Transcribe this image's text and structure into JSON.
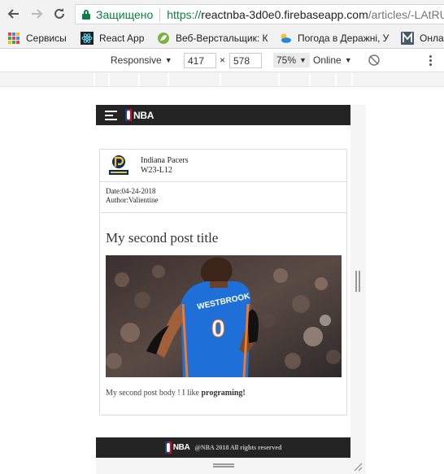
{
  "browser": {
    "security_label": "Защищено",
    "url_scheme": "https://",
    "url_host": "reactnba-3d0e0.firebaseapp.com",
    "url_path": "/articles/-LAtRU"
  },
  "bookmarks": [
    {
      "label": "Сервисы",
      "icon": "apps-grid-icon"
    },
    {
      "label": "React App",
      "icon": "react-icon"
    },
    {
      "label": "Веб-Верстальщик: К",
      "icon": "leaf-icon"
    },
    {
      "label": "Погода в Деражні, У",
      "icon": "weather-icon"
    },
    {
      "label": "Онла",
      "icon": "m-icon"
    }
  ],
  "devtools": {
    "device": "Responsive",
    "width": "417",
    "times": "×",
    "height": "578",
    "zoom": "75%",
    "throttle": "Online"
  },
  "page": {
    "logo_text": "NBA",
    "team": {
      "name": "Indiana Pacers",
      "record": "W23-L12"
    },
    "article": {
      "date": "Date:04-24-2018",
      "author": "Author:Valientine",
      "title": "My second post title",
      "body_prefix": "My second post body ! I like ",
      "body_bold": "programing!"
    },
    "footer": {
      "logo_text": "NBA",
      "copyright": "@NBA 2018 All rights reserved"
    }
  },
  "colors": {
    "secure_green": "#0b8043",
    "nba_bar": "#242424",
    "thunder_blue": "#1e70d8",
    "pacers_navy": "#002d62",
    "pacers_gold": "#fdbb30"
  }
}
